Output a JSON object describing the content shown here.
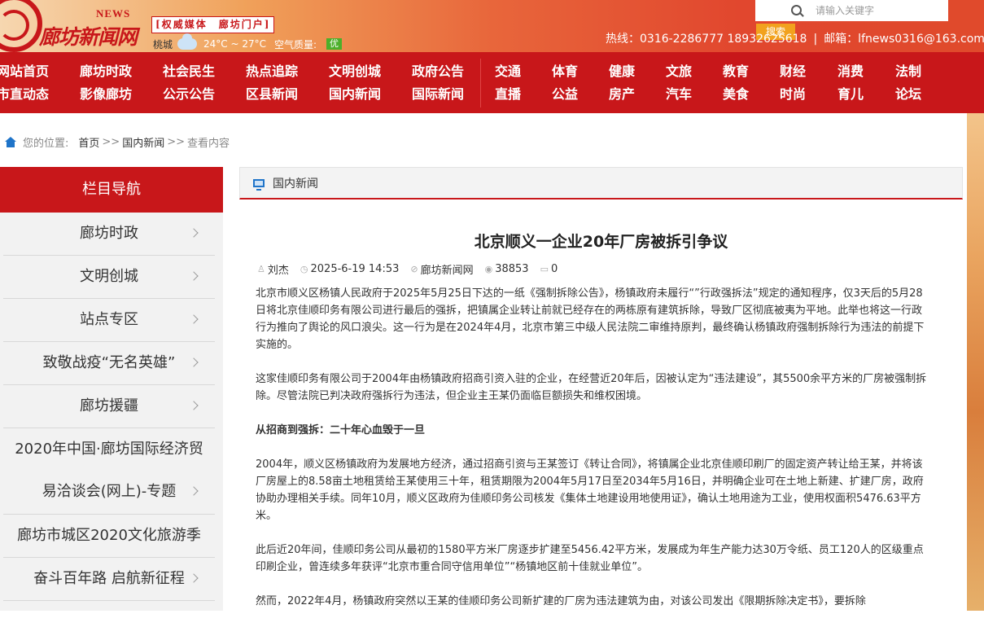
{
  "header": {
    "logo_news": "NEWS",
    "logo_text": "廊坊新闻网",
    "slogan": "权威媒体　廊坊门户",
    "weather": {
      "city": "桃城",
      "temp": "24°C ~ 27°C",
      "air_label": "空气质量:",
      "air_value": "优"
    },
    "search": {
      "placeholder": "请输入关键字",
      "button": "搜索"
    },
    "hotline": "热线：0316-2286777 18932625618",
    "email": "邮箱：lfnews0316@163.com"
  },
  "nav": {
    "columns": [
      [
        "网站首页",
        "市直动态"
      ],
      [
        "廊坊时政",
        "影像廊坊"
      ],
      [
        "社会民生",
        "公示公告"
      ],
      [
        "热点追踪",
        "区县新闻"
      ],
      [
        "文明创城",
        "国内新闻"
      ],
      [
        "政府公告",
        "国际新闻"
      ],
      [
        "交通",
        "直播"
      ],
      [
        "体育",
        "公益"
      ],
      [
        "健康",
        "房产"
      ],
      [
        "文旅",
        "汽车"
      ],
      [
        "教育",
        "美食"
      ],
      [
        "财经",
        "时尚"
      ],
      [
        "消费",
        "育儿"
      ],
      [
        "法制",
        "论坛"
      ]
    ]
  },
  "breadcrumb": {
    "prefix": "您的位置:",
    "home": "首页",
    "section": "国内新闻",
    "current": "查看内容"
  },
  "sidebar": {
    "title": "栏目导航",
    "items": [
      "廊坊时政",
      "文明创城",
      "站点专区",
      "致敬战疫“无名英雄”",
      "廊坊援疆",
      "2020年中国·廊坊国际经济贸易洽谈会(网上)-专题",
      "廊坊市城区2020文化旅游季",
      "奋斗百年路 启航新征程"
    ]
  },
  "panel": {
    "title": "国内新闻"
  },
  "article": {
    "title": "北京顺义一企业20年厂房被拆引争议",
    "author": "刘杰",
    "date": "2025-6-19 14:53",
    "source": "廊坊新闻网",
    "views": "38853",
    "comments": "0",
    "paragraphs": [
      "北京市顺义区杨镇人民政府于2025年5月25日下达的一纸《强制拆除公告》，杨镇政府未履行“”行政强拆法”规定的通知程序，仅3天后的5月28日将北京佳顺印务有限公司进行最后的强拆，把镇属企业转让前就已经存在的两栋原有建筑拆除，导致厂区彻底被夷为平地。此举也将这一行政行为推向了舆论的风口浪尖。这一行为是在2024年4月，北京市第三中级人民法院二审维持原判，最终确认杨镇政府强制拆除行为违法的前提下实施的。",
      "这家佳顺印务有限公司于2004年由杨镇政府招商引资入驻的企业，在经营近20年后，因被认定为“违法建设”，其5500余平方米的厂房被强制拆除。尽管法院已判决政府强拆行为违法，但企业主王某仍面临巨额损失和维权困境。",
      "从招商到强拆：二十年心血毁于一旦",
      "2004年，顺义区杨镇政府为发展地方经济，通过招商引资与王某签订《转让合同》，将镇属企业北京佳顺印刷厂的固定资产转让给王某，并将该厂房屋上的8.58亩土地租赁给王某使用三十年，租赁期限为2004年5月17日至2034年5月16日，并明确企业可在土地上新建、扩建厂房，政府协助办理相关手续。同年10月，顺义区政府为佳顺印务公司核发《集体土地建设用地使用证》，确认土地用途为工业，使用权面积5476.63平方米。",
      "此后近20年间，佳顺印务公司从最初的1580平方米厂房逐步扩建至5456.42平方米，发展成为年生产能力达30万令纸、员工120人的区级重点印刷企业，曾连续多年获评“北京市重合同守信用单位”“杨镇地区前十佳就业单位”。",
      "然而，2022年4月，杨镇政府突然以王某的佳顺印务公司新扩建的厂房为违法建筑为由，对该公司发出《限期拆除决定书》，要拆除"
    ]
  }
}
